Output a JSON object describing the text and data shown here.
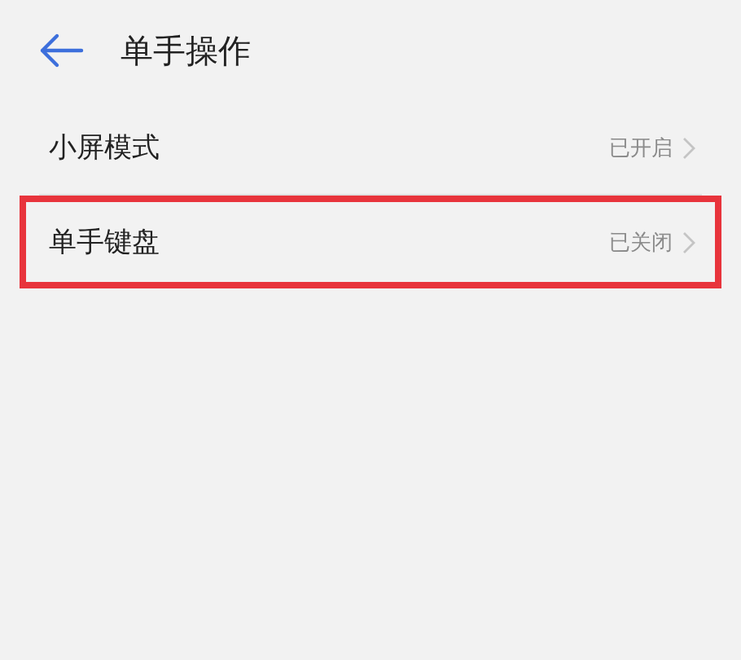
{
  "header": {
    "title": "单手操作"
  },
  "rows": [
    {
      "label": "小屏模式",
      "value": "已开启",
      "highlighted": false
    },
    {
      "label": "单手键盘",
      "value": "已关闭",
      "highlighted": true
    }
  ]
}
